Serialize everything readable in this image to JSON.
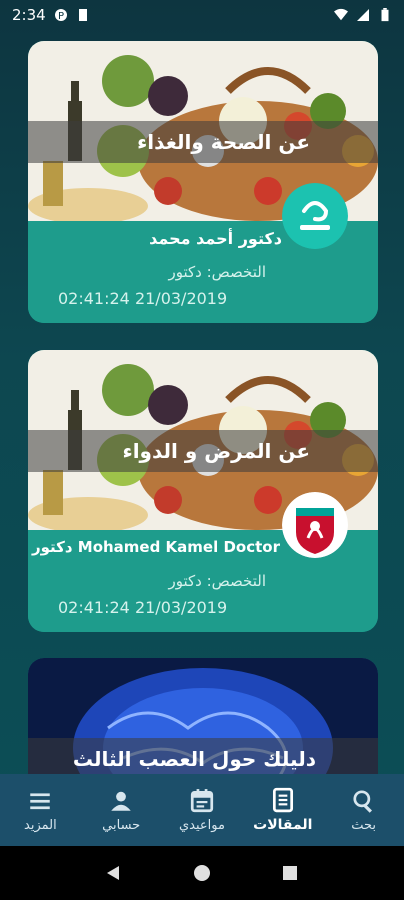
{
  "status": {
    "time": "2:34"
  },
  "articles": [
    {
      "title": "عن الصحة والغذاء",
      "author": "دكتور أحمد محمد",
      "specialty": "التخصص: دكتور",
      "date": "02:41:24 21/03/2019",
      "badge": "logo-tebyan",
      "image": "food-basket"
    },
    {
      "title": "عن المرض و الدواء",
      "author": "Mohamed Kamel Doctor دكتور",
      "specialty": "التخصص: دكتور",
      "date": "02:41:24 21/03/2019",
      "badge": "logo-liverpool",
      "image": "food-basket"
    },
    {
      "title": "دليلك حول العصب الثالث",
      "image": "brain"
    }
  ],
  "nav": {
    "search": "بحث",
    "articles": "المقالات",
    "appointments": "مواعيدي",
    "account": "حسابي",
    "more": "المزيد"
  },
  "colors": {
    "card_bg": "#1e9c8c",
    "nav_bg": "#1c4f6a",
    "page_bg": "#0d4750"
  }
}
